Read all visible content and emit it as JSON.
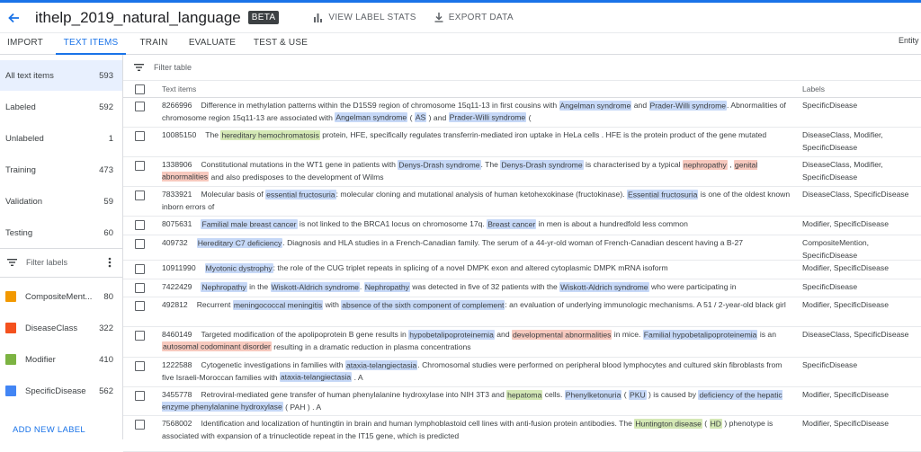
{
  "header": {
    "title": "ithelp_2019_natural_language",
    "badge": "BETA",
    "view_stats": "VIEW LABEL STATS",
    "export": "EXPORT DATA"
  },
  "tabs": [
    "IMPORT",
    "TEXT ITEMS",
    "TRAIN",
    "EVALUATE",
    "TEST & USE"
  ],
  "tabs_right_truncated": "Entity E",
  "sidebar": {
    "filters": [
      {
        "label": "All text items",
        "count": "593"
      },
      {
        "label": "Labeled",
        "count": "592"
      },
      {
        "label": "Unlabeled",
        "count": "1"
      },
      {
        "label": "Training",
        "count": "473"
      },
      {
        "label": "Validation",
        "count": "59"
      },
      {
        "label": "Testing",
        "count": "60"
      }
    ],
    "filter_labels_placeholder": "Filter labels",
    "labels": [
      {
        "name": "CompositeMent...",
        "count": "80",
        "color": "#f29900"
      },
      {
        "name": "DiseaseClass",
        "count": "322",
        "color": "#f4511e"
      },
      {
        "name": "Modifier",
        "count": "410",
        "color": "#7cb342"
      },
      {
        "name": "SpecificDisease",
        "count": "562",
        "color": "#4285f4"
      }
    ],
    "add_label": "ADD NEW LABEL"
  },
  "main": {
    "filter_placeholder": "Filter table",
    "col_text": "Text items",
    "col_labels": "Labels"
  },
  "rows": [
    {
      "id": "8266996",
      "labels": "SpecificDisease",
      "segments": [
        {
          "t": "Difference in methylation patterns within the D15S9 region of chromosome 15q11-13 in first cousins with "
        },
        {
          "t": "Angelman syndrome",
          "h": "SpecificDisease"
        },
        {
          "t": " and "
        },
        {
          "t": "Prader-Willi syndrome",
          "h": "SpecificDisease"
        },
        {
          "t": ". Abnormalities of chromosome region 15q11-13 are associated with "
        },
        {
          "t": "Angelman syndrome",
          "h": "SpecificDisease"
        },
        {
          "t": " ( "
        },
        {
          "t": "AS",
          "h": "SpecificDisease"
        },
        {
          "t": " ) and "
        },
        {
          "t": "Prader-Willi syndrome",
          "h": "SpecificDisease"
        },
        {
          "t": " ("
        }
      ]
    },
    {
      "id": "10085150",
      "labels": "DiseaseClass, Modifier, SpecificDisease",
      "segments": [
        {
          "t": "The "
        },
        {
          "t": "hereditary hemochromatosis",
          "h": "Modifier"
        },
        {
          "t": " protein, HFE, specifically regulates transferrin-mediated iron uptake in HeLa cells . HFE is the protein product of the gene mutated"
        }
      ]
    },
    {
      "id": "1338906",
      "labels": "DiseaseClass, Modifier, SpecificDisease",
      "segments": [
        {
          "t": "Constitutional mutations in the WT1 gene in patients with "
        },
        {
          "t": "Denys-Drash syndrome",
          "h": "SpecificDisease"
        },
        {
          "t": ".     The "
        },
        {
          "t": "Denys-Drash syndrome",
          "h": "SpecificDisease"
        },
        {
          "t": " is characterised by a typical "
        },
        {
          "t": "nephropathy",
          "h": "DiseaseClass"
        },
        {
          "t": " , "
        },
        {
          "t": "genital abnormalities",
          "h": "DiseaseClass"
        },
        {
          "t": " and also predisposes to the development of Wilms"
        }
      ]
    },
    {
      "id": "7833921",
      "labels": "DiseaseClass, SpecificDisease",
      "segments": [
        {
          "t": "Molecular basis of "
        },
        {
          "t": "essential fructosuria",
          "h": "SpecificDisease"
        },
        {
          "t": ": molecular cloning and mutational analysis of human ketohexokinase (fructokinase). "
        },
        {
          "t": "Essential fructosuria",
          "h": "SpecificDisease"
        },
        {
          "t": " is one of the oldest known inborn errors of"
        }
      ]
    },
    {
      "id": "8075631",
      "labels": "Modifier, SpecificDisease",
      "segments": [
        {
          "t": "Familial male breast cancer",
          "h": "SpecificDisease"
        },
        {
          "t": " is not linked to the BRCA1 locus on chromosome 17q.     "
        },
        {
          "t": "Breast cancer",
          "h": "SpecificDisease"
        },
        {
          "t": " in men is about a hundredfold less common"
        }
      ]
    },
    {
      "id": "409732",
      "labels": "CompositeMention, SpecificDisease",
      "segments": [
        {
          "t": "Hereditary C7 deficiency",
          "h": "SpecificDisease"
        },
        {
          "t": ". Diagnosis and HLA studies in a French-Canadian family.     The serum of a 44-yr-old woman of French-Canadian descent having a B-27"
        }
      ]
    },
    {
      "id": "10911990",
      "labels": "Modifier, SpecificDisease",
      "segments": [
        {
          "t": "Myotonic dystrophy",
          "h": "SpecificDisease"
        },
        {
          "t": ": the role of the CUG triplet repeats in splicing of a novel DMPK exon and altered cytoplasmic DMPK mRNA isoform"
        }
      ]
    },
    {
      "id": "7422429",
      "labels": "SpecificDisease",
      "segments": [
        {
          "t": "Nephropathy",
          "h": "SpecificDisease"
        },
        {
          "t": " in the "
        },
        {
          "t": "Wiskott-Aldrich syndrome",
          "h": "SpecificDisease"
        },
        {
          "t": ".     "
        },
        {
          "t": "Nephropathy",
          "h": "SpecificDisease"
        },
        {
          "t": " was detected in five of 32 patients with the "
        },
        {
          "t": "Wiskott-Aldrich syndrome",
          "h": "SpecificDisease"
        },
        {
          "t": " who were participating in"
        }
      ]
    },
    {
      "id": "492812",
      "labels": "Modifier, SpecificDisease",
      "segments": [
        {
          "t": "Recurrent "
        },
        {
          "t": "meningococcal meningitis",
          "h": "SpecificDisease"
        },
        {
          "t": " with "
        },
        {
          "t": "absence of the sixth component of complement",
          "h": "SpecificDisease"
        },
        {
          "t": ": an evaluation of underlying immunologic mechanisms.   A 51 / 2-year-old black girl"
        }
      ]
    },
    {
      "id": "8460149",
      "labels": "DiseaseClass, SpecificDisease",
      "segments": [
        {
          "t": "Targeted modification of the apolipoprotein B gene results in "
        },
        {
          "t": "hypobetalipoproteinemia",
          "h": "SpecificDisease"
        },
        {
          "t": " and "
        },
        {
          "t": "developmental abnormalities",
          "h": "DiseaseClass"
        },
        {
          "t": " in mice.   "
        },
        {
          "t": "Familial hypobetalipoproteinemia",
          "h": "SpecificDisease"
        },
        {
          "t": " is an "
        },
        {
          "t": "autosomal codominant disorder",
          "h": "DiseaseClass"
        },
        {
          "t": " resulting in a dramatic reduction in plasma concentrations"
        }
      ]
    },
    {
      "id": "1222588",
      "labels": "SpecificDisease",
      "segments": [
        {
          "t": "Cytogenetic investigations in families with "
        },
        {
          "t": "ataxia-telangiectasia",
          "h": "SpecificDisease"
        },
        {
          "t": ".     Chromosomal studies were performed on peripheral blood lymphocytes and cultured skin fibroblasts from five Israeli-Moroccan families with "
        },
        {
          "t": "ataxia-telangiectasia",
          "h": "SpecificDisease"
        },
        {
          "t": " . A"
        }
      ]
    },
    {
      "id": "3455778",
      "labels": "Modifier, SpecificDisease",
      "segments": [
        {
          "t": "Retroviral-mediated gene transfer of human phenylalanine hydroxylase into NIH 3T3 and "
        },
        {
          "t": "hepatoma",
          "h": "Modifier"
        },
        {
          "t": " cells.     "
        },
        {
          "t": "Phenylketonuria",
          "h": "SpecificDisease"
        },
        {
          "t": " ( "
        },
        {
          "t": "PKU",
          "h": "SpecificDisease"
        },
        {
          "t": " ) is caused by "
        },
        {
          "t": "deficiency of the hepatic enzyme phenylalanine hydroxylase",
          "h": "SpecificDisease"
        },
        {
          "t": " ( PAH ) . A"
        }
      ]
    },
    {
      "id": "7568002",
      "labels": "Modifier, SpecificDisease",
      "segments": [
        {
          "t": "Identification and localization of huntingtin in brain and human lymphoblastoid cell lines with anti-fusion protein antibodies.     The "
        },
        {
          "t": "Huntington disease",
          "h": "Modifier"
        },
        {
          "t": " ( "
        },
        {
          "t": "HD",
          "h": "Modifier"
        },
        {
          "t": " ) phenotype is associated with expansion of a trinucleotide repeat in the IT15 gene, which is predicted"
        }
      ]
    }
  ]
}
